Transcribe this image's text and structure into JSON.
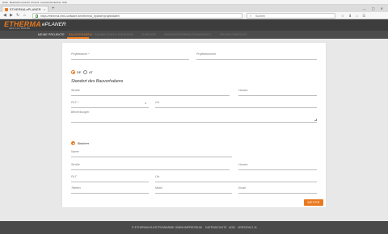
{
  "os_menu": [
    "Datei",
    "Bearbeiten",
    "Ansicht",
    "Chronik",
    "Lesezeichen",
    "Extras",
    "Hilfe"
  ],
  "browser": {
    "tab_title": "ETHERMA ePLANER",
    "tab_close": "×",
    "new_tab": "+",
    "window_controls": "— ▢ ✕",
    "back": "◀",
    "forward": "▶",
    "reload": "↻",
    "home": "⌂",
    "url": "https://etherma.mbs-software.de/etherma_eplaner/projektdaten",
    "search_placeholder": "Suchen",
    "toolbar_icons": "☆ ⬇ ⌂ ☰"
  },
  "app": {
    "logo_text": "ETHERMA",
    "logo_tagline": "GENIALE WÄRME",
    "title": "ePLANER",
    "nav": [
      {
        "label": "MEINE PROJEKTE",
        "state": "done"
      },
      {
        "label": "BAUVORHABEN",
        "state": "active"
      },
      {
        "label": "RÄUME/ZONEN",
        "state": "inactive"
      },
      {
        "label": "ERGEBNIS",
        "state": "inactive"
      },
      {
        "label": "ZUBEHÖR",
        "state": "inactive"
      },
      {
        "label": "ENERGIEVERBRAUCH",
        "state": "inactive"
      },
      {
        "label": "ANGEBOT",
        "state": "inactive"
      },
      {
        "label": "PROJEKTBERICHT",
        "state": "inactive"
      }
    ]
  },
  "form": {
    "project_name_label": "Projektname *",
    "project_number_label": "Projektnummer",
    "country_options": [
      "DE",
      "AT"
    ],
    "country_selected": "DE",
    "site_section_title": "Standort des Bauvorhabens",
    "street_label": "Straße",
    "house_number_label": "Hausnr.",
    "zip_label": "PLZ *",
    "city_label": "Ort",
    "clear_symbol": "×",
    "remarks_label": "Bemerkungen",
    "role_label": "Bauherr",
    "contact": {
      "name_label": "Name",
      "street_label": "Straße",
      "house_number_label": "Hausnr.",
      "zip_label": "PLZ",
      "city_label": "Ort",
      "phone_label": "Telefon",
      "mobile_label": "Mobil",
      "email_label": "Email"
    },
    "next_button": "WEITER"
  },
  "footer": [
    "© ETHERMA ELEKTROWÄRME GMBH",
    "IMPRESSUM",
    "DATENSCHUTZ",
    "AGB",
    "VERSION 2.11"
  ],
  "colors": {
    "accent": "#e8791f",
    "header_bg": "#3d3d3d",
    "nav_bg": "#4c4c4c",
    "footer_bg": "#4a4a4a"
  }
}
